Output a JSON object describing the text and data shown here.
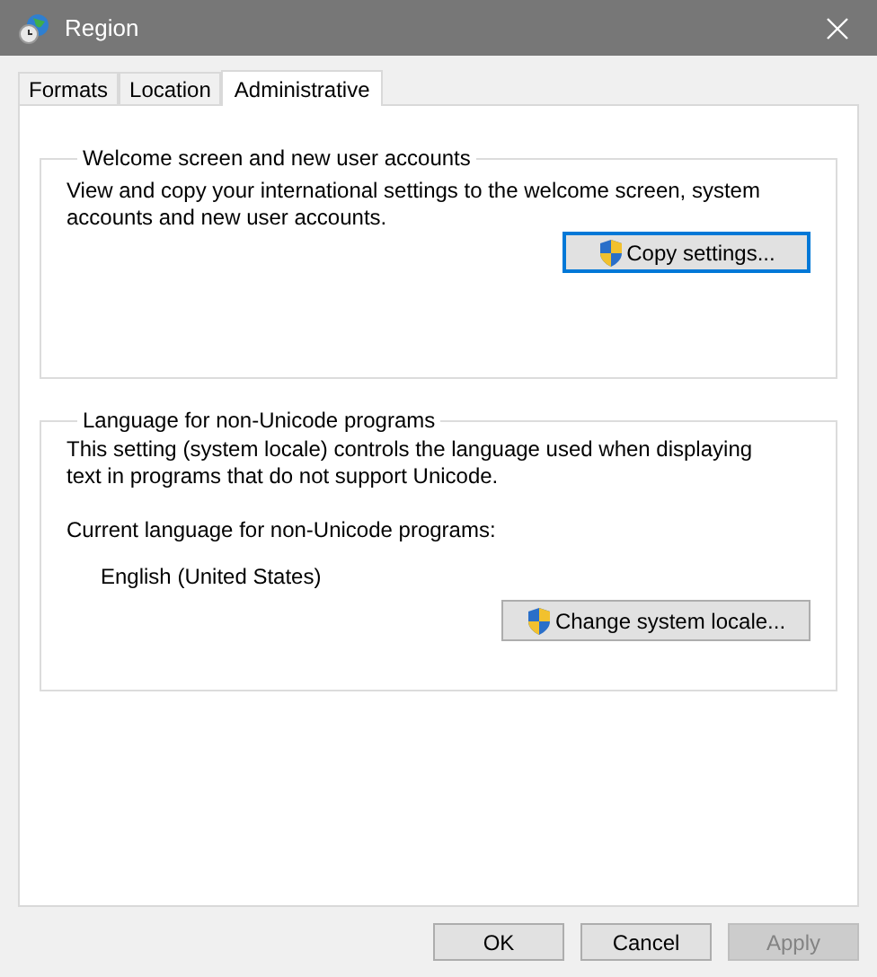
{
  "window": {
    "title": "Region"
  },
  "tabs": [
    {
      "label": "Formats",
      "selected": false
    },
    {
      "label": "Location",
      "selected": false
    },
    {
      "label": "Administrative",
      "selected": true
    }
  ],
  "groups": [
    {
      "title": "Welcome screen and new user accounts",
      "description": "View and copy your international settings to the welcome screen, system accounts and new user accounts.",
      "button": {
        "label": "Copy settings...",
        "focused": true
      }
    },
    {
      "title": "Language for non-Unicode programs",
      "description": "This setting (system locale) controls the language used when displaying text in programs that do not support Unicode.",
      "current_label": "Current language for non-Unicode programs:",
      "current_value": "English (United States)",
      "button": {
        "label": "Change system locale...",
        "focused": false
      }
    }
  ],
  "buttons": [
    {
      "label": "OK",
      "disabled": false
    },
    {
      "label": "Cancel",
      "disabled": false
    },
    {
      "label": "Apply",
      "disabled": true
    }
  ]
}
